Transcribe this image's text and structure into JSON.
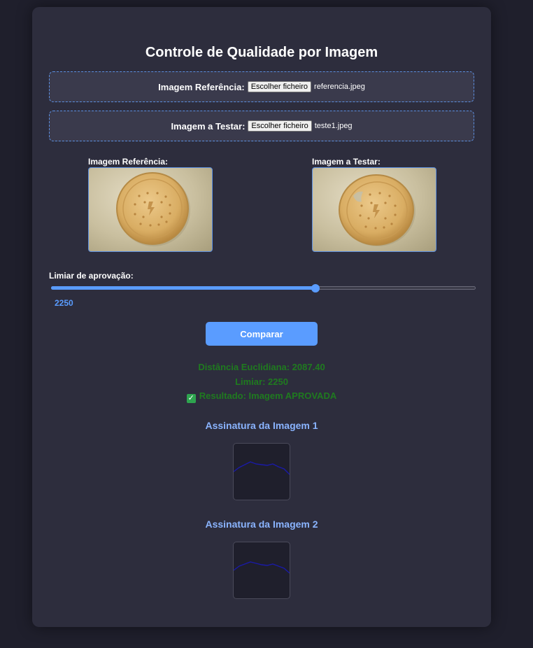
{
  "header": {
    "title": "Controle de Qualidade por Imagem"
  },
  "upload_reference": {
    "label": "Imagem Referência:",
    "button": "Escolher ficheiro",
    "file": "referencia.jpeg"
  },
  "upload_test": {
    "label": "Imagem a Testar:",
    "button": "Escolher ficheiro",
    "file": "teste1.jpeg"
  },
  "previews": {
    "reference_label": "Imagem Referência:",
    "test_label": "Imagem a Testar:"
  },
  "threshold": {
    "label": "Limiar de aprovação:",
    "value": "2250",
    "fraction": 0.623
  },
  "compare_button": "Comparar",
  "results": {
    "distance": "Distância Euclidiana: 2087.40",
    "threshold": "Limiar: 2250",
    "verdict": "Resultado: Imagem APROVADA",
    "verdict_icon": "check-icon"
  },
  "signature1": {
    "title": "Assinatura da Imagem 1"
  },
  "signature2": {
    "title": "Assinatura da Imagem 2"
  },
  "colors": {
    "accent": "#5a9cff",
    "success": "#1f7a1f",
    "signature_line": "#1a1aa8"
  }
}
